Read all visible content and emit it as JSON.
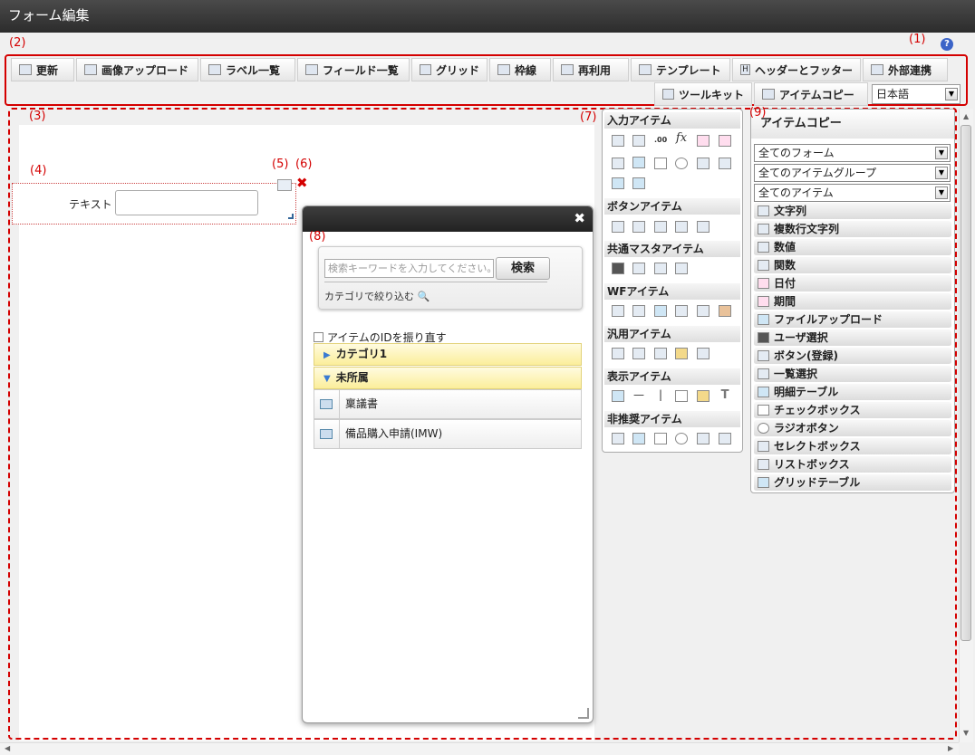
{
  "window": {
    "title": "フォーム編集"
  },
  "annotations": {
    "a1": "(1)",
    "a2": "(2)",
    "a3": "(3)",
    "a4": "(4)",
    "a5": "(5)",
    "a6": "(6)",
    "a7": "(7)",
    "a8": "(8)",
    "a9": "(9)"
  },
  "help": {
    "icon": "help-icon",
    "glyph": "?"
  },
  "toolbar": {
    "refresh": "更新",
    "image_upload": "画像アップロード",
    "label_list": "ラベル一覧",
    "field_list": "フィールド一覧",
    "grid": "グリッド",
    "border": "枠線",
    "reuse": "再利用",
    "template": "テンプレート",
    "header_footer": "ヘッダーとフッター",
    "external": "外部連携",
    "toolkit": "ツールキット",
    "item_copy": "アイテムコピー",
    "language": "日本語"
  },
  "canvas": {
    "text_label": "テキスト"
  },
  "dialog": {
    "search_placeholder": "検索キーワードを入力してください。",
    "search_button": "検索",
    "filter_link": "カテゴリで絞り込む",
    "renumber": "アイテムのIDを振り直す",
    "category1": "カテゴリ1",
    "uncategorized": "未所属",
    "rows": [
      "稟議書",
      "備品購入申請(IMW)"
    ]
  },
  "palette": {
    "sections": [
      "入力アイテム",
      "ボタンアイテム",
      "共通マスタアイテム",
      "WFアイテム",
      "汎用アイテム",
      "表示アイテム",
      "非推奨アイテム"
    ],
    "fx": "fx",
    "numeric": ".00"
  },
  "item_copy": {
    "title": "アイテムコピー",
    "form_select": "全てのフォーム",
    "group_select": "全てのアイテムグループ",
    "item_select": "全てのアイテム",
    "items": [
      "文字列",
      "複数行文字列",
      "数値",
      "関数",
      "日付",
      "期間",
      "ファイルアップロード",
      "ユーザ選択",
      "ボタン(登録)",
      "一覧選択",
      "明細テーブル",
      "チェックボックス",
      "ラジオボタン",
      "セレクトボックス",
      "リストボックス",
      "グリッドテーブル"
    ]
  }
}
